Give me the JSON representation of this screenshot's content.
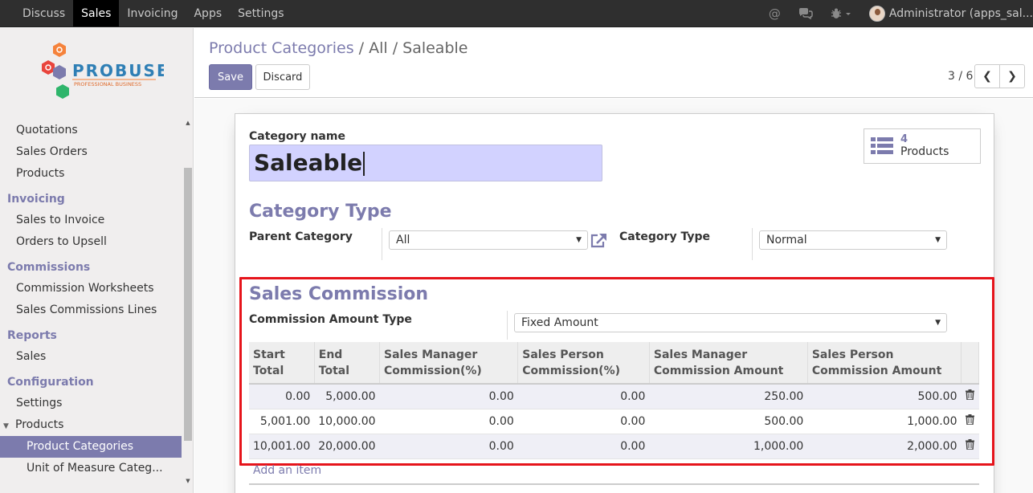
{
  "topnav": {
    "menu": [
      {
        "label": "Discuss",
        "active": false
      },
      {
        "label": "Sales",
        "active": true
      },
      {
        "label": "Invoicing",
        "active": false
      },
      {
        "label": "Apps",
        "active": false
      },
      {
        "label": "Settings",
        "active": false
      }
    ],
    "user": "Administrator (apps_sal..."
  },
  "logo": {
    "brand": "PROBUSE",
    "tagline": "PROFESSIONAL BUSINESS"
  },
  "sidebar": {
    "sales_items": [
      "Quotations",
      "Sales Orders",
      "Products"
    ],
    "invoicing": {
      "title": "Invoicing",
      "items": [
        "Sales to Invoice",
        "Orders to Upsell"
      ]
    },
    "commissions": {
      "title": "Commissions",
      "items": [
        "Commission Worksheets",
        "Sales Commissions Lines"
      ]
    },
    "reports": {
      "title": "Reports",
      "items": [
        "Sales"
      ]
    },
    "configuration": {
      "title": "Configuration",
      "settings": "Settings",
      "products": "Products",
      "product_categories": "Product Categories",
      "uom_categories": "Unit of Measure Categ..."
    }
  },
  "breadcrumb": {
    "root": "Product Categories",
    "sep": "/",
    "current": "All / Saleable"
  },
  "buttons": {
    "save": "Save",
    "discard": "Discard"
  },
  "pager": {
    "text": "3 / 6"
  },
  "form": {
    "category_name_label": "Category name",
    "category_name": "Saleable",
    "products_count": "4",
    "products_label": "Products",
    "category_type_section": "Category Type",
    "parent_category_label": "Parent Category",
    "parent_category": "All",
    "category_type_label": "Category Type",
    "category_type": "Normal",
    "sales_commission_section": "Sales Commission",
    "commission_amount_type_label": "Commission Amount Type",
    "commission_amount_type": "Fixed Amount",
    "add_item": "Add an item"
  },
  "commission_table": {
    "headers": [
      "Start Total",
      "End Total",
      "Sales Manager Commission(%)",
      "Sales Person Commission(%)",
      "Sales Manager Commission Amount",
      "Sales Person Commission Amount"
    ],
    "rows": [
      [
        "0.00",
        "5,000.00",
        "0.00",
        "0.00",
        "250.00",
        "500.00"
      ],
      [
        "5,001.00",
        "10,000.00",
        "0.00",
        "0.00",
        "500.00",
        "1,000.00"
      ],
      [
        "10,001.00",
        "20,000.00",
        "0.00",
        "0.00",
        "1,000.00",
        "2,000.00"
      ]
    ]
  },
  "colors": {
    "accent": "#7c7bad",
    "highlight": "#e6141b",
    "navbar": "#2f2f2f"
  }
}
